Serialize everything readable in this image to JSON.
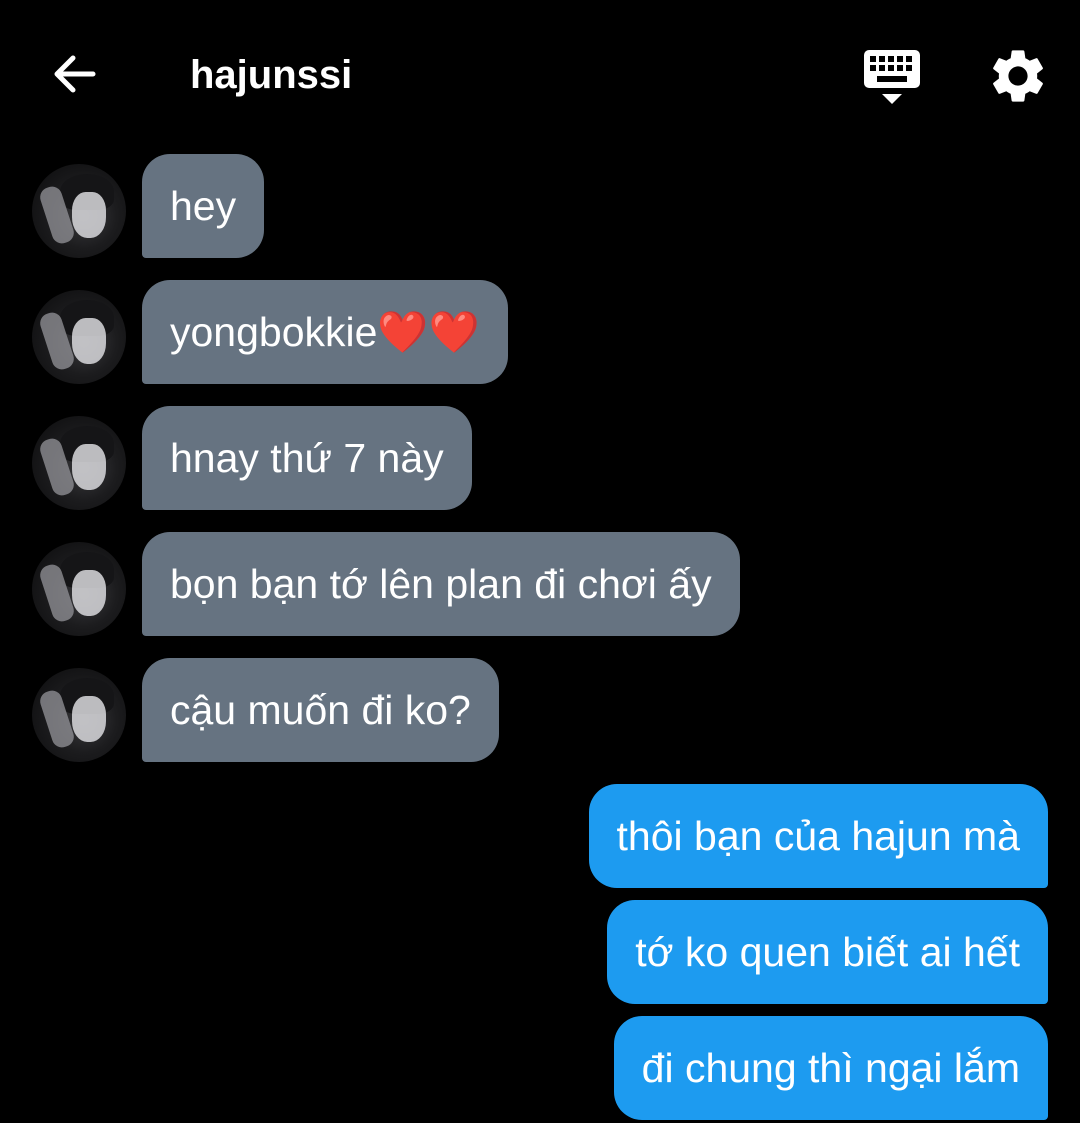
{
  "header": {
    "title": "hajunssi",
    "back_icon": "arrow-left-icon",
    "keyboard_icon": "keyboard-hide-icon",
    "settings_icon": "gear-icon"
  },
  "colors": {
    "background": "#000000",
    "incoming_bubble": "#667381",
    "outgoing_bubble": "#1d9bf0",
    "text": "#ffffff"
  },
  "messages": [
    {
      "from": "them",
      "text": "hey"
    },
    {
      "from": "them",
      "text": "yongbokkie❤️❤️"
    },
    {
      "from": "them",
      "text": "hnay thứ 7 này"
    },
    {
      "from": "them",
      "text": "bọn bạn tớ lên plan đi chơi ấy"
    },
    {
      "from": "them",
      "text": "cậu muốn đi ko?"
    },
    {
      "from": "me",
      "text": "thôi bạn của hajun mà"
    },
    {
      "from": "me",
      "text": "tớ ko quen biết ai hết"
    },
    {
      "from": "me",
      "text": "đi chung thì ngại lắm"
    }
  ]
}
